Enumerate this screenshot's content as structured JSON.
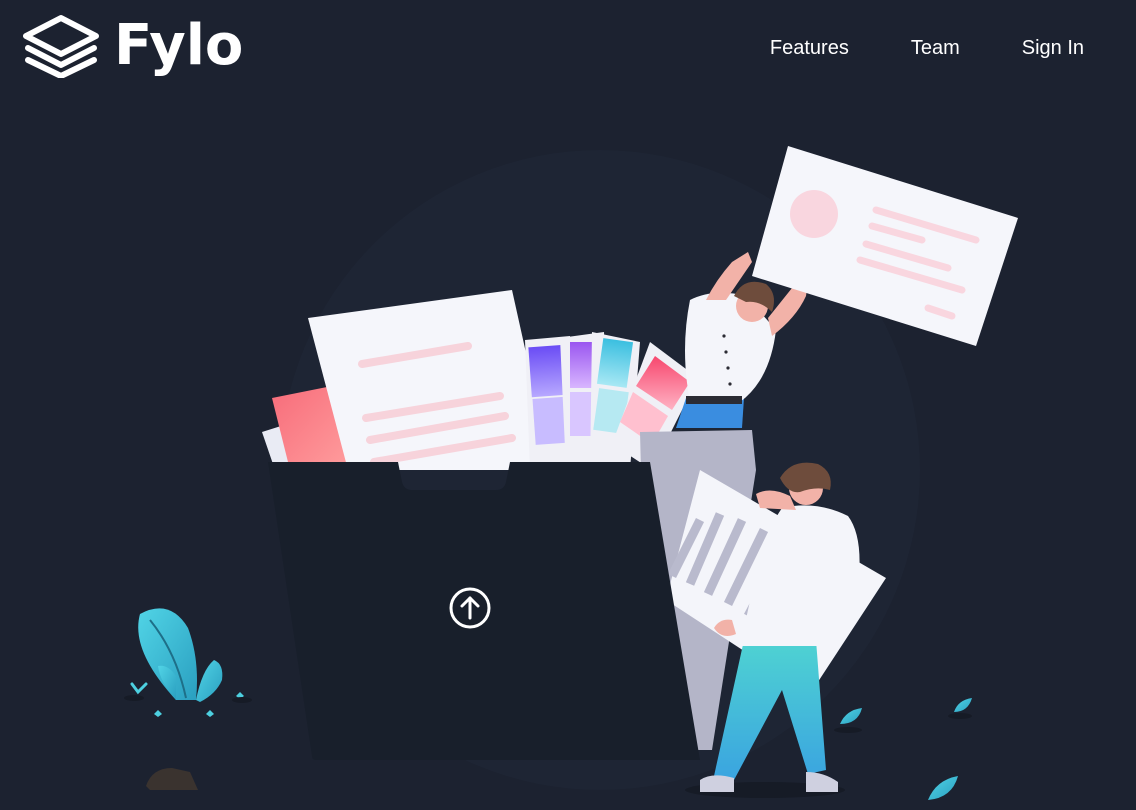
{
  "brand": {
    "name": "Fylo",
    "logo_icon": "stacked-layers-icon"
  },
  "nav": {
    "items": [
      {
        "label": "Features"
      },
      {
        "label": "Team"
      },
      {
        "label": "Sign In"
      }
    ]
  },
  "hero": {
    "illustration": "people-filling-folder-illustration",
    "upload_icon": "arrow-up-circle-icon"
  },
  "colors": {
    "background": "#1c2230",
    "folder_front": "#181f2b",
    "folder_back": "#b4b5c8",
    "accent_cyan": "#4dd0d8",
    "accent_pink": "#f76c8a",
    "text": "#ffffff"
  }
}
